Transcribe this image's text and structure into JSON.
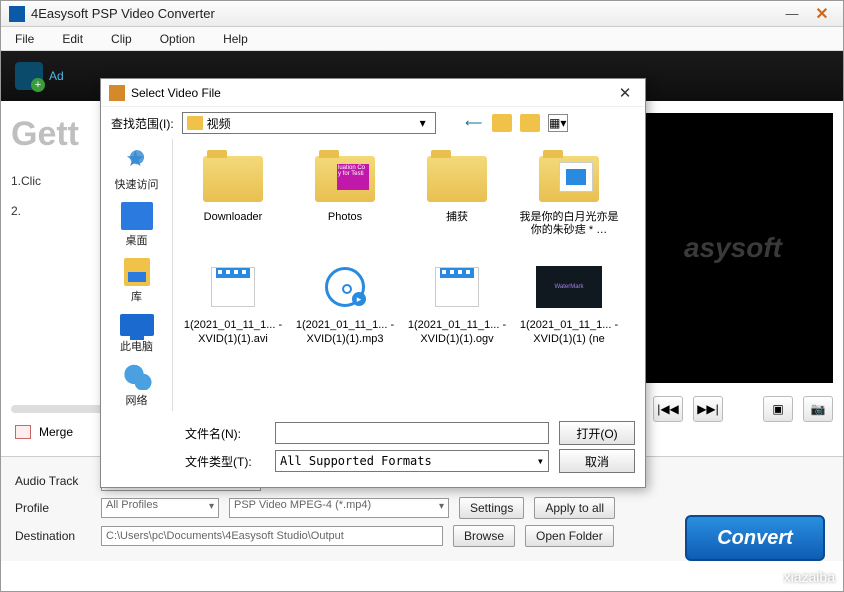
{
  "window": {
    "title": "4Easysoft PSP Video Converter",
    "menus": [
      "File",
      "Edit",
      "Clip",
      "Option",
      "Help"
    ]
  },
  "toolbar": {
    "add_label": "Ad"
  },
  "main": {
    "heading": "Gett",
    "step1": "1.Clic",
    "step2": "2.",
    "preview_watermark": "asysoft",
    "merge_label": "Merge"
  },
  "controls": {
    "audio_track_label": "Audio Track",
    "profile_label": "Profile",
    "profile_group": "All Profiles",
    "profile_value": "PSP Video MPEG-4 (*.mp4)",
    "settings_btn": "Settings",
    "apply_all_btn": "Apply to all",
    "dest_label": "Destination",
    "dest_value": "C:\\Users\\pc\\Documents\\4Easysoft Studio\\Output",
    "browse_btn": "Browse",
    "open_folder_btn": "Open Folder",
    "convert_btn": "Convert"
  },
  "dialog": {
    "title": "Select Video File",
    "lookin_label": "查找范围(I):",
    "lookin_value": "视频",
    "places": [
      {
        "label": "快速访问"
      },
      {
        "label": "桌面"
      },
      {
        "label": "库"
      },
      {
        "label": "此电脑"
      },
      {
        "label": "网络"
      }
    ],
    "files_row1": [
      {
        "label": "Downloader",
        "type": "folder"
      },
      {
        "label": "Photos",
        "type": "folder-thumb"
      },
      {
        "label": "捕获",
        "type": "folder"
      },
      {
        "label": "我是你的白月光亦是你的朱砂痣 *  …",
        "type": "folder-blue"
      }
    ],
    "files_row2": [
      {
        "label": "1(2021_01_11_1... - XVID(1)(1).avi",
        "type": "video"
      },
      {
        "label": "1(2021_01_11_1... - XVID(1)(1).mp3",
        "type": "disc"
      },
      {
        "label": "1(2021_01_11_1... - XVID(1)(1).ogv",
        "type": "video"
      },
      {
        "label": "1(2021_01_11_1... - XVID(1)(1) (ne",
        "type": "thumb"
      }
    ],
    "filename_label": "文件名(N):",
    "filename_value": "",
    "filetype_label": "文件类型(T):",
    "filetype_value": "All Supported Formats",
    "open_btn": "打开(O)",
    "cancel_btn": "取消"
  }
}
